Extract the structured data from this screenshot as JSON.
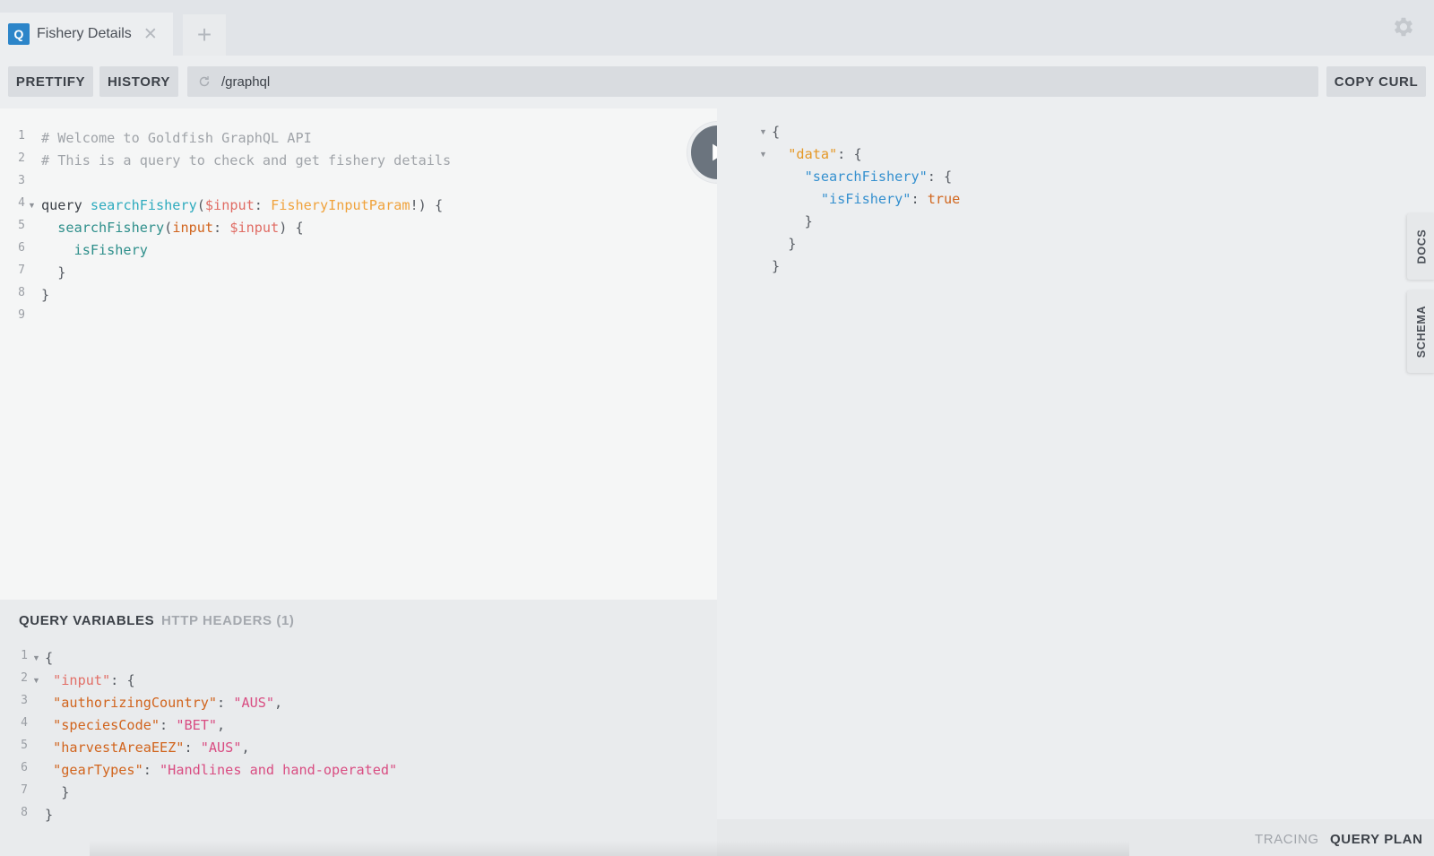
{
  "tab": {
    "badge": "Q",
    "title": "Fishery Details",
    "close": "✕",
    "add": "+"
  },
  "toolbar": {
    "prettify": "PRETTIFY",
    "history": "HISTORY",
    "url": "/graphql",
    "copy_curl": "COPY CURL"
  },
  "query_lines": [
    {
      "n": "1",
      "tokens": [
        {
          "t": "# Welcome to Goldfish GraphQL API",
          "c": "c-comment"
        }
      ]
    },
    {
      "n": "2",
      "tokens": [
        {
          "t": "# This is a query to check and get fishery details",
          "c": "c-comment"
        }
      ]
    },
    {
      "n": "3",
      "tokens": []
    },
    {
      "n": "4",
      "fold": true,
      "tokens": [
        {
          "t": "query ",
          "c": "c-kw"
        },
        {
          "t": "searchFishery",
          "c": "c-def"
        },
        {
          "t": "(",
          "c": "c-punct"
        },
        {
          "t": "$input",
          "c": "c-var"
        },
        {
          "t": ": ",
          "c": "c-punct"
        },
        {
          "t": "FisheryInputParam",
          "c": "c-type"
        },
        {
          "t": "!) {",
          "c": "c-punct"
        }
      ]
    },
    {
      "n": "5",
      "tokens": [
        {
          "t": "  searchFishery",
          "c": "c-field"
        },
        {
          "t": "(",
          "c": "c-punct"
        },
        {
          "t": "input",
          "c": "c-arg"
        },
        {
          "t": ": ",
          "c": "c-punct"
        },
        {
          "t": "$input",
          "c": "c-var"
        },
        {
          "t": ") {",
          "c": "c-punct"
        }
      ]
    },
    {
      "n": "6",
      "tokens": [
        {
          "t": "    isFishery",
          "c": "c-field"
        }
      ]
    },
    {
      "n": "7",
      "tokens": [
        {
          "t": "  }",
          "c": "c-punct"
        }
      ]
    },
    {
      "n": "8",
      "tokens": [
        {
          "t": "}",
          "c": "c-punct"
        }
      ]
    },
    {
      "n": "9",
      "tokens": []
    }
  ],
  "vars_panel": {
    "tab_variables": "QUERY VARIABLES",
    "tab_headers": "HTTP HEADERS (1)"
  },
  "var_lines": [
    {
      "n": "1",
      "fold": true,
      "tokens": [
        {
          "t": "{",
          "c": "c-punct"
        }
      ]
    },
    {
      "n": "2",
      "fold": true,
      "tokens": [
        {
          "t": " \"input\"",
          "c": "c-key"
        },
        {
          "t": ": {",
          "c": "c-punct"
        }
      ]
    },
    {
      "n": "3",
      "tokens": [
        {
          "t": " \"authorizingCountry\"",
          "c": "c-arg"
        },
        {
          "t": ": ",
          "c": "c-punct"
        },
        {
          "t": "\"AUS\"",
          "c": "c-str"
        },
        {
          "t": ",",
          "c": "c-punct"
        }
      ]
    },
    {
      "n": "4",
      "tokens": [
        {
          "t": " \"speciesCode\"",
          "c": "c-arg"
        },
        {
          "t": ": ",
          "c": "c-punct"
        },
        {
          "t": "\"BET\"",
          "c": "c-str"
        },
        {
          "t": ",",
          "c": "c-punct"
        }
      ]
    },
    {
      "n": "5",
      "tokens": [
        {
          "t": " \"harvestAreaEEZ\"",
          "c": "c-arg"
        },
        {
          "t": ": ",
          "c": "c-punct"
        },
        {
          "t": "\"AUS\"",
          "c": "c-str"
        },
        {
          "t": ",",
          "c": "c-punct"
        }
      ]
    },
    {
      "n": "6",
      "tokens": [
        {
          "t": " \"gearTypes\"",
          "c": "c-arg"
        },
        {
          "t": ": ",
          "c": "c-punct"
        },
        {
          "t": "\"Handlines and hand-operated\"",
          "c": "c-str"
        }
      ]
    },
    {
      "n": "7",
      "tokens": [
        {
          "t": "  }",
          "c": "c-punct"
        }
      ]
    },
    {
      "n": "8",
      "tokens": [
        {
          "t": "}",
          "c": "c-punct"
        }
      ]
    }
  ],
  "result_lines": [
    {
      "fold": true,
      "tokens": [
        {
          "t": "{",
          "c": "c-punct"
        }
      ]
    },
    {
      "fold": true,
      "tokens": [
        {
          "t": "  \"data\"",
          "c": "c-rdata"
        },
        {
          "t": ": {",
          "c": "c-punct"
        }
      ]
    },
    {
      "tokens": [
        {
          "t": "    \"searchFishery\"",
          "c": "c-rkey"
        },
        {
          "t": ": {",
          "c": "c-punct"
        }
      ]
    },
    {
      "tokens": [
        {
          "t": "      \"isFishery\"",
          "c": "c-rkey"
        },
        {
          "t": ": ",
          "c": "c-punct"
        },
        {
          "t": "true",
          "c": "c-bool"
        }
      ]
    },
    {
      "tokens": [
        {
          "t": "    }",
          "c": "c-punct"
        }
      ]
    },
    {
      "tokens": [
        {
          "t": "  }",
          "c": "c-punct"
        }
      ]
    },
    {
      "tokens": [
        {
          "t": "}",
          "c": "c-punct"
        }
      ]
    }
  ],
  "side_tabs": {
    "docs": "DOCS",
    "schema": "SCHEMA"
  },
  "footer": {
    "tracing": "TRACING",
    "query_plan": "QUERY PLAN"
  },
  "icons": {
    "gear": "gear-icon",
    "reload": "reload-icon",
    "play": "play-icon"
  },
  "colors": {
    "accent": "#2c85c9",
    "run_button": "#6b747e"
  }
}
